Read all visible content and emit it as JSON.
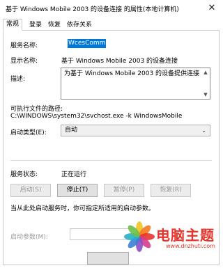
{
  "window": {
    "title": "基于 Windows Mobile 2003 的设备连接 的属性(本地计算机)",
    "close_glyph": "✕"
  },
  "tabs": [
    "常规",
    "登录",
    "恢复",
    "依存关系"
  ],
  "general": {
    "service_name_label": "服务名称:",
    "service_name_value": "WcesComm",
    "display_name_label": "显示名称:",
    "display_name_value": "基于 Windows Mobile 2003 的设备连接",
    "description_label": "描述:",
    "description_value": "为基于 Windows Mobile 2003 的设备提供连接",
    "exe_path_label": "可执行文件的路径:",
    "exe_path_value": "C:\\WINDOWS\\system32\\svchost.exe -k WindowsMobile",
    "startup_type_label": "启动类型(E):",
    "startup_type_value": "自动",
    "service_status_label": "服务状态:",
    "service_status_value": "正在运行",
    "buttons": {
      "start": "启动(S)",
      "stop": "停止(T)",
      "pause": "暂停(P)",
      "resume": "恢复(R)"
    },
    "hint_text": "当从此处启动服务时，你可指定所适用的启动参数。",
    "start_params_label": "启动参数(M):",
    "start_params_value": ""
  },
  "watermark": {
    "title": "电脑主题",
    "url": "www.dnzhuti.com"
  },
  "colors": {
    "accent_selection": "#0078d7",
    "watermark_red": "#e8342b"
  }
}
